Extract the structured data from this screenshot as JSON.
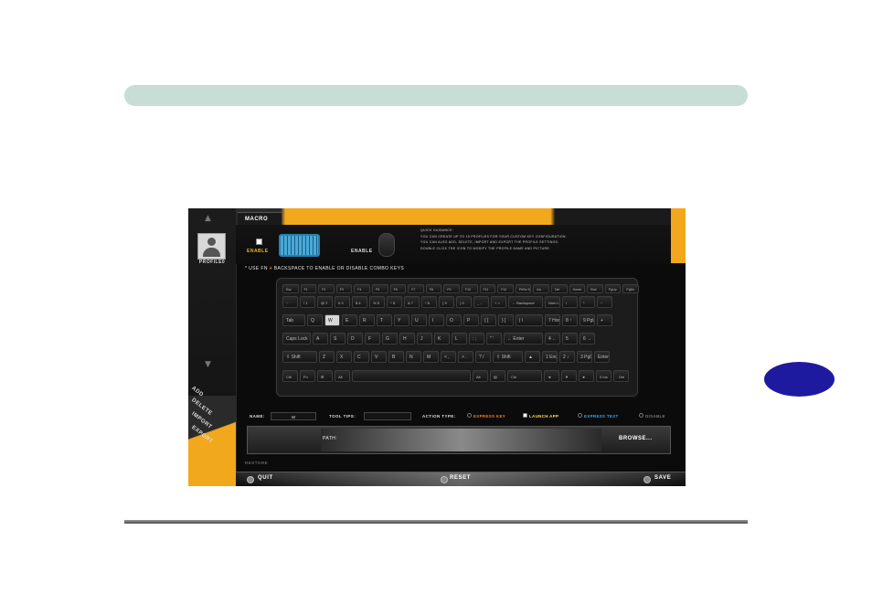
{
  "page": {
    "colors": {
      "header_bar": "#c8ddd6",
      "chapter_tab": "#1e1aa0",
      "accent_orange": "#f2a81c",
      "express_key": "#ff7a1a",
      "launch_app": "#ffe046",
      "express_text": "#2ea7ff"
    }
  },
  "app": {
    "tab_macro": "MACRO",
    "sidebar": {
      "profile_label": "PROFILE0",
      "up_icon": "chevron-up-icon",
      "down_icon": "chevron-down-icon",
      "actions": [
        "ADD",
        "DELETE",
        "IMPORT",
        "EXPORT"
      ]
    },
    "enable_keyboard_label": "ENABLE",
    "enable_mouse_label": "ENABLE",
    "info_lines": [
      "QUICK GUIDANCE:",
      "YOU CAN CREATE UP TO 15 PROFILES FOR YOUR CUSTOM KEY CONFIGURATION.",
      "YOU CAN ALSO ADD, DELETE, IMPORT AND EXPORT THE PROFILE SETTINGS.",
      "DOUBLE CLICK THE ICON TO MODIFY THE PROFILE NAME AND PICTURE."
    ],
    "hint": {
      "prefix": "* USE FN",
      "plus": "+",
      "rest": "BACKSPACE TO ENABLE OR DISABLE COMBO KEYS"
    },
    "keyboard": {
      "fn_row": [
        "Esc",
        "F1",
        "F2",
        "F3",
        "F4",
        "F5",
        "F6",
        "F7",
        "F8",
        "F9",
        "F10",
        "F11",
        "F12",
        "PrtSc SysRq",
        "Ins",
        "Del",
        "Home",
        "End",
        "PgUp",
        "PgDn"
      ],
      "num_row": [
        "~ `",
        "! 1",
        "@ 2",
        "# 3",
        "$ 4",
        "% 5",
        "^ 6",
        "& 7",
        "* 8",
        "( 9",
        ") 0",
        "_ -",
        "+ =",
        "← Backspace",
        "Num Lk",
        "/",
        "*",
        "−"
      ],
      "tab_row": [
        "Tab",
        "Q",
        "W",
        "E",
        "R",
        "T",
        "Y",
        "U",
        "I",
        "O",
        "P",
        "{ [",
        "} ]",
        "| \\",
        "7 Home",
        "8 ↑",
        "9 PgUp",
        "+"
      ],
      "caps_row": [
        "Caps Lock",
        "A",
        "S",
        "D",
        "F",
        "G",
        "H",
        "J",
        "K",
        "L",
        ": ;",
        "\" '",
        "← Enter",
        "4 ←",
        "5",
        "6 →"
      ],
      "shift_row": [
        "⇧ Shift",
        "Z",
        "X",
        "C",
        "V",
        "B",
        "N",
        "M",
        "< ,",
        "> .",
        "? /",
        "⇧ Shift",
        "▲",
        "1 End",
        "2 ↓",
        "3 PgDn",
        "Enter"
      ],
      "bottom_row": [
        "Ctrl",
        "Fn",
        "⊞",
        "Alt",
        "",
        "Alt",
        "▤",
        "Ctrl",
        "◄",
        "▼",
        "►",
        "0 Ins",
        ". Del"
      ],
      "selected_key": "W"
    },
    "name_row": {
      "name_label": "NAME:",
      "name_value": "W",
      "tooltips_label": "TOOL TIPS:",
      "tooltips_value": "",
      "action_label": "ACTION TYPE:",
      "options": [
        "EXPRESS KEY",
        "LAUNCH APP",
        "EXPRESS TEXT",
        "DISABLE"
      ],
      "selected_option": "LAUNCH APP"
    },
    "path_label": "PATH:",
    "browse_label": "BROWSE...",
    "restore_label": "RESTORE",
    "bottom": {
      "quit": "QUIT",
      "reset": "RESET",
      "save": "SAVE"
    }
  }
}
